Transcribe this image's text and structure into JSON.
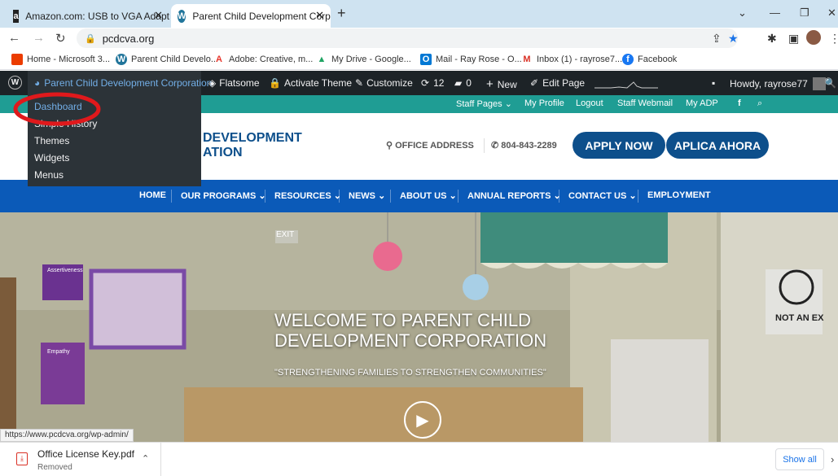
{
  "browser": {
    "tabs": [
      {
        "label": "Amazon.com: USB to VGA Adapt",
        "favicon": "a"
      },
      {
        "label": "Parent Child Development Corpo",
        "favicon": "W"
      }
    ],
    "new_tab": "+",
    "url": "pcdcva.org",
    "bookmarks": [
      {
        "label": "Home - Microsoft 3...",
        "icon": "office-icon"
      },
      {
        "label": "Parent Child Develo...",
        "icon": "wordpress-icon"
      },
      {
        "label": "Adobe: Creative, m...",
        "icon": "adobe-icon"
      },
      {
        "label": "My Drive - Google...",
        "icon": "drive-icon"
      },
      {
        "label": "Mail - Ray Rose - O...",
        "icon": "outlook-icon"
      },
      {
        "label": "Inbox (1) - rayrose7...",
        "icon": "gmail-icon"
      },
      {
        "label": "Facebook",
        "icon": "facebook-icon"
      }
    ]
  },
  "wpbar": {
    "site_name": "Parent Child Development Corporation",
    "theme": "Flatsome",
    "activate": "Activate Theme",
    "customize": "Customize",
    "updates": "12",
    "comments": "0",
    "new": "New",
    "edit": "Edit Page",
    "howdy": "Howdy, rayrose77"
  },
  "dropdown": {
    "items": [
      "Dashboard",
      "Simple History",
      "Themes",
      "Widgets",
      "Menus"
    ]
  },
  "site_top": {
    "links": [
      "Staff Pages",
      "My Profile",
      "Logout",
      "Staff Webmail",
      "My ADP"
    ]
  },
  "header": {
    "logo_line1": "DEVELOPMENT",
    "logo_line2": "ATION",
    "office": "OFFICE ADDRESS",
    "phone": "804-843-2289",
    "apply": "APPLY NOW",
    "aplica": "APLICA AHORA"
  },
  "nav": {
    "items": [
      "HOME",
      "OUR PROGRAMS",
      "RESOURCES",
      "NEWS",
      "ABOUT US",
      "ANNUAL REPORTS",
      "CONTACT US",
      "EMPLOYMENT"
    ]
  },
  "hero": {
    "title1": "WELCOME TO PARENT CHILD",
    "title2": "DEVELOPMENT CORPORATION",
    "tagline": "\"STRENGTHENING FAMILIES TO STRENGTHEN COMMUNITIES\"",
    "exit_sign": "EXIT",
    "wall_sign": "NOT AN EX",
    "poster1": "Assertiveness",
    "poster2": "Empathy"
  },
  "status_url": "https://www.pcdcva.org/wp-admin/",
  "download": {
    "filename": "Office License Key.pdf",
    "status": "Removed",
    "show_all": "Show all"
  },
  "colors": {
    "wp_bar": "#1d2327",
    "teal": "#1f9d94",
    "nav_blue": "#0b5ab8",
    "button_blue": "#0d4f8b",
    "highlight_red": "#e0191c"
  }
}
